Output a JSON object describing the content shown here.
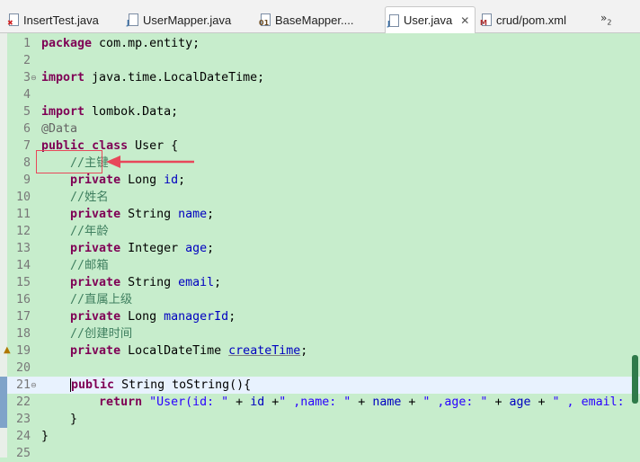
{
  "tabs": [
    {
      "label": "InsertTest.java",
      "icon": "java-error-file-icon"
    },
    {
      "label": "UserMapper.java",
      "icon": "java-file-icon"
    },
    {
      "label": "BaseMapper....",
      "icon": "class-file-icon"
    },
    {
      "label": "User.java",
      "icon": "java-file-icon",
      "active": true
    },
    {
      "label": "crud/pom.xml",
      "icon": "maven-file-icon"
    }
  ],
  "tab_close": "✕",
  "tab_overflow": {
    "symbol": "»",
    "count": "2"
  },
  "lines": [
    {
      "n": "1",
      "tokens": [
        {
          "t": "package",
          "c": "kw"
        },
        {
          "t": " com.mp.entity;"
        }
      ]
    },
    {
      "n": "2",
      "tokens": []
    },
    {
      "n": "3",
      "tokens": [
        {
          "t": "import",
          "c": "kw"
        },
        {
          "t": " java.time.LocalDateTime;"
        }
      ]
    },
    {
      "n": "4",
      "tokens": []
    },
    {
      "n": "5",
      "tokens": [
        {
          "t": "import",
          "c": "kw"
        },
        {
          "t": " lombok.Data;"
        }
      ]
    },
    {
      "n": "6",
      "tokens": [
        {
          "t": "@Data",
          "c": "an"
        }
      ]
    },
    {
      "n": "7",
      "tokens": [
        {
          "t": "public",
          "c": "kw"
        },
        {
          "t": " "
        },
        {
          "t": "class",
          "c": "kw"
        },
        {
          "t": " User {"
        }
      ]
    },
    {
      "n": "8",
      "tokens": [
        {
          "t": "    "
        },
        {
          "t": "//主键",
          "c": "cm"
        }
      ]
    },
    {
      "n": "9",
      "tokens": [
        {
          "t": "    "
        },
        {
          "t": "private",
          "c": "kw"
        },
        {
          "t": " Long "
        },
        {
          "t": "id",
          "c": "fd"
        },
        {
          "t": ";"
        }
      ]
    },
    {
      "n": "10",
      "tokens": [
        {
          "t": "    "
        },
        {
          "t": "//姓名",
          "c": "cm"
        }
      ]
    },
    {
      "n": "11",
      "tokens": [
        {
          "t": "    "
        },
        {
          "t": "private",
          "c": "kw"
        },
        {
          "t": " String "
        },
        {
          "t": "name",
          "c": "fd"
        },
        {
          "t": ";"
        }
      ]
    },
    {
      "n": "12",
      "tokens": [
        {
          "t": "    "
        },
        {
          "t": "//年龄",
          "c": "cm"
        }
      ]
    },
    {
      "n": "13",
      "tokens": [
        {
          "t": "    "
        },
        {
          "t": "private",
          "c": "kw"
        },
        {
          "t": " Integer "
        },
        {
          "t": "age",
          "c": "fd"
        },
        {
          "t": ";"
        }
      ]
    },
    {
      "n": "14",
      "tokens": [
        {
          "t": "    "
        },
        {
          "t": "//邮箱",
          "c": "cm"
        }
      ]
    },
    {
      "n": "15",
      "tokens": [
        {
          "t": "    "
        },
        {
          "t": "private",
          "c": "kw"
        },
        {
          "t": " String "
        },
        {
          "t": "email",
          "c": "fd"
        },
        {
          "t": ";"
        }
      ]
    },
    {
      "n": "16",
      "tokens": [
        {
          "t": "    "
        },
        {
          "t": "//直属上级",
          "c": "cm"
        }
      ]
    },
    {
      "n": "17",
      "tokens": [
        {
          "t": "    "
        },
        {
          "t": "private",
          "c": "kw"
        },
        {
          "t": " Long "
        },
        {
          "t": "managerId",
          "c": "fd"
        },
        {
          "t": ";"
        }
      ]
    },
    {
      "n": "18",
      "tokens": [
        {
          "t": "    "
        },
        {
          "t": "//创建时间",
          "c": "cm"
        }
      ]
    },
    {
      "n": "19",
      "tokens": [
        {
          "t": "    "
        },
        {
          "t": "private",
          "c": "kw"
        },
        {
          "t": " LocalDateTime "
        },
        {
          "t": "createTime",
          "c": "fd ul"
        },
        {
          "t": ";"
        }
      ]
    },
    {
      "n": "20",
      "tokens": []
    },
    {
      "n": "21",
      "tokens": [
        {
          "t": "    "
        },
        {
          "t": "public",
          "c": "kw"
        },
        {
          "t": " String toString(){"
        }
      ]
    },
    {
      "n": "22",
      "tokens": [
        {
          "t": "        "
        },
        {
          "t": "return",
          "c": "kw"
        },
        {
          "t": " "
        },
        {
          "t": "\"User(id: \"",
          "c": "st"
        },
        {
          "t": " + "
        },
        {
          "t": "id",
          "c": "fd"
        },
        {
          "t": " +"
        },
        {
          "t": "\" ,name: \"",
          "c": "st"
        },
        {
          "t": " + "
        },
        {
          "t": "name",
          "c": "fd"
        },
        {
          "t": " + "
        },
        {
          "t": "\" ,age: \"",
          "c": "st"
        },
        {
          "t": " + "
        },
        {
          "t": "age",
          "c": "fd"
        },
        {
          "t": " + "
        },
        {
          "t": "\" , email: \"",
          "c": "st"
        }
      ]
    },
    {
      "n": "23",
      "tokens": [
        {
          "t": "    }"
        }
      ]
    },
    {
      "n": "24",
      "tokens": [
        {
          "t": "}"
        }
      ]
    },
    {
      "n": "25",
      "tokens": []
    }
  ],
  "current_line": "21",
  "fold_markers": [
    "3",
    "21"
  ],
  "override_marker_line": "19",
  "colors": {
    "editor_bg": "#c7edcc",
    "keyword": "#7f0055",
    "comment": "#3f7f5f",
    "field": "#0000c0",
    "string": "#2a00ff",
    "annotation_highlight": "#e8475a"
  }
}
